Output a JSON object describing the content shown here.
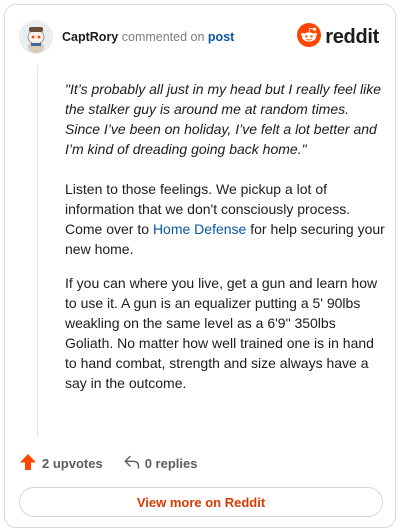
{
  "header": {
    "username": "CaptRory",
    "action_text": "commented on",
    "target_link": "post",
    "brand": "reddit",
    "avatar_icon": "snoo-avatar-icon",
    "logo_icon": "reddit-logo-icon"
  },
  "comment": {
    "quote": "\"It’s probably all just in my head but I really feel like the stalker guy is around me at random times. Since I’ve been on holiday, I’ve felt a lot better and I’m kind of dreading going back home.\"",
    "para2_before": "Listen to those feelings. We pickup a lot of information that we don't consciously process. Come over to ",
    "para2_link": "Home Defense",
    "para2_after": " for help securing your new home.",
    "para3": "If you can where you live, get a gun and learn how to use it. A gun is an equalizer putting a 5' 90lbs weakling on the same level as a 6'9\" 350lbs Goliath. No matter how well trained one is in hand to hand combat, strength and size always have a say in the outcome."
  },
  "footer": {
    "upvotes": "2 upvotes",
    "replies": "0 replies",
    "upvote_icon": "upvote-arrow-icon",
    "reply_icon": "reply-icon",
    "view_more": "View more on Reddit"
  },
  "colors": {
    "brand": "#ff4500",
    "link": "#0a57a4",
    "view_more_text": "#d93a00"
  }
}
